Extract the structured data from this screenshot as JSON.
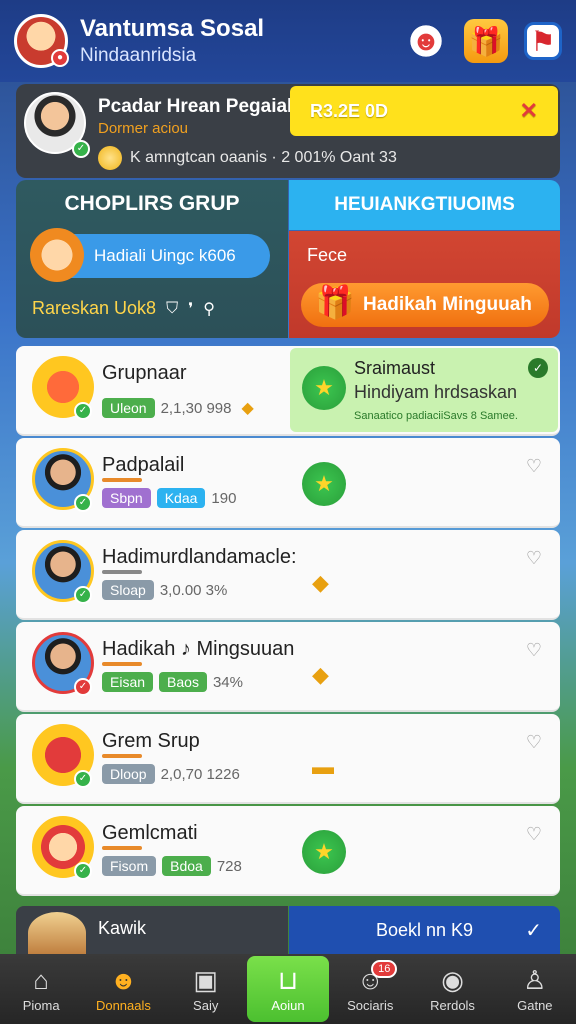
{
  "header": {
    "title": "Vantumsa Sosal",
    "subtitle": "Nindaanridsia"
  },
  "profile": {
    "name": "Pcadar Hrean Pegaial",
    "role": "Dormer aciou",
    "stats": "K amngtcan oaanis · 2 001% Oant 33",
    "banner_value": "R3.2E 0D",
    "banner_close": "✕"
  },
  "group": {
    "title": "CHOPLIRS GRUP",
    "pill_label": "Hadiali Uingc k606",
    "footer": "Rareskan Uok8"
  },
  "rankings": {
    "title": "HEUIANKGTIUOIMS"
  },
  "free": {
    "label": "Fece",
    "button": "Hadikah Minguuah"
  },
  "list": [
    {
      "title": "Grupnaar",
      "tag1": "Uleon",
      "meta": "2,1,30 998",
      "avatar": "gift",
      "tag_color": "green"
    },
    {
      "title": "Padpalail",
      "tag1": "Sbpn",
      "tag2": "Kdaa",
      "meta": "190",
      "avatar": "person",
      "tag_color": "purple"
    },
    {
      "title": "Hadimurdlandamacle:",
      "tag1": "Sloap",
      "meta": "3,0.00 3%",
      "avatar": "person",
      "tag_color": "gray"
    },
    {
      "title": "Hadikah ♪ Mingsuuan",
      "tag1": "Eisan",
      "tag2": "Baos",
      "meta": "34%",
      "avatar": "person",
      "tag_color": "green"
    },
    {
      "title": "Grem Srup",
      "tag1": "Dloop",
      "meta": "2,0,70 1226",
      "avatar": "basket",
      "tag_color": "gray"
    },
    {
      "title": "Gemlcmati",
      "tag1": "Fisom",
      "tag2": "Bdoa",
      "meta": "728",
      "avatar": "mascot",
      "tag_color": "gray"
    }
  ],
  "highlight": {
    "title": "Sraimaust",
    "subtitle": "Hindiyam hrdsaskan",
    "note": "Sanaatico padiaciiSavs 8 Samee."
  },
  "bottom_row": {
    "left_title": "Kawik",
    "right_title": "Boekl nn K9"
  },
  "tabs": [
    {
      "label": "Pioma",
      "icon": "home-icon"
    },
    {
      "label": "Donnaals",
      "icon": "mascot-icon"
    },
    {
      "label": "Saiy",
      "icon": "chat-icon"
    },
    {
      "label": "Aoiun",
      "icon": "center-icon"
    },
    {
      "label": "Sociaris",
      "icon": "group-icon",
      "badge": "16"
    },
    {
      "label": "Rerdols",
      "icon": "avatar-icon"
    },
    {
      "label": "Gatne",
      "icon": "profile-icon"
    }
  ]
}
